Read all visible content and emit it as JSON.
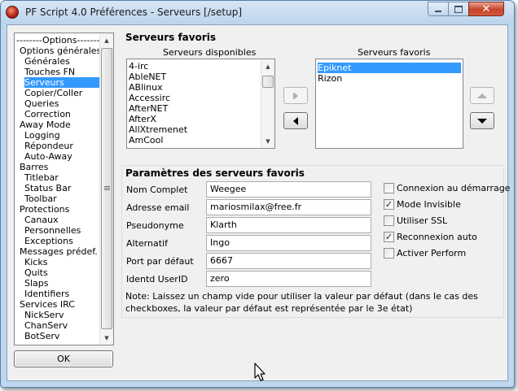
{
  "window": {
    "title": "PF Script 4.0 Préférences - Serveurs [/setup]",
    "close_glyph": "✕"
  },
  "tree": {
    "items": [
      {
        "label": "--------Options--------",
        "indent": 0,
        "selected": false
      },
      {
        "label": "Options générales",
        "indent": 1,
        "selected": false
      },
      {
        "label": "Générales",
        "indent": 2,
        "selected": false
      },
      {
        "label": "Touches FN",
        "indent": 2,
        "selected": false
      },
      {
        "label": "Serveurs",
        "indent": 2,
        "selected": true
      },
      {
        "label": "Copier/Coller",
        "indent": 2,
        "selected": false
      },
      {
        "label": "Queries",
        "indent": 2,
        "selected": false
      },
      {
        "label": "Correction",
        "indent": 2,
        "selected": false
      },
      {
        "label": "Away Mode",
        "indent": 1,
        "selected": false
      },
      {
        "label": "Logging",
        "indent": 2,
        "selected": false
      },
      {
        "label": "Répondeur",
        "indent": 2,
        "selected": false
      },
      {
        "label": "Auto-Away",
        "indent": 2,
        "selected": false
      },
      {
        "label": "Barres",
        "indent": 1,
        "selected": false
      },
      {
        "label": "Titlebar",
        "indent": 2,
        "selected": false
      },
      {
        "label": "Status Bar",
        "indent": 2,
        "selected": false
      },
      {
        "label": "Toolbar",
        "indent": 2,
        "selected": false
      },
      {
        "label": "Protections",
        "indent": 1,
        "selected": false
      },
      {
        "label": "Canaux",
        "indent": 2,
        "selected": false
      },
      {
        "label": "Personnelles",
        "indent": 2,
        "selected": false
      },
      {
        "label": "Exceptions",
        "indent": 2,
        "selected": false
      },
      {
        "label": "Messages prédef.",
        "indent": 1,
        "selected": false
      },
      {
        "label": "Kicks",
        "indent": 2,
        "selected": false
      },
      {
        "label": "Quits",
        "indent": 2,
        "selected": false
      },
      {
        "label": "Slaps",
        "indent": 2,
        "selected": false
      },
      {
        "label": "Identifiers",
        "indent": 2,
        "selected": false
      },
      {
        "label": "Services IRC",
        "indent": 1,
        "selected": false
      },
      {
        "label": "NickServ",
        "indent": 2,
        "selected": false
      },
      {
        "label": "ChanServ",
        "indent": 2,
        "selected": false
      },
      {
        "label": "BotServ",
        "indent": 2,
        "selected": false
      }
    ]
  },
  "ok_label": "OK",
  "servers": {
    "section_title": "Serveurs favoris",
    "available_header": "Serveurs disponibles",
    "favorites_header": "Serveurs favoris",
    "available": [
      "4-irc",
      "AbleNET",
      "ABlinux",
      "Accessirc",
      "AfterNET",
      "AfterX",
      "AllXtremenet",
      "AmCool"
    ],
    "favorites": [
      {
        "label": "Epiknet",
        "selected": true
      },
      {
        "label": "Rizon",
        "selected": false
      }
    ]
  },
  "params": {
    "section_title": "Paramètres des serveurs favoris",
    "fields": [
      {
        "label": "Nom Complet",
        "value": "Weegee"
      },
      {
        "label": "Adresse email",
        "value": "mariosmilax@free.fr"
      },
      {
        "label": "Pseudonyme",
        "value": "Klarth"
      },
      {
        "label": "Alternatif",
        "value": "Ingo"
      },
      {
        "label": "Port par défaut",
        "value": "6667"
      },
      {
        "label": "Identd UserID",
        "value": "zero"
      }
    ],
    "checkboxes": [
      {
        "label": "Connexion au démarrage",
        "checked": false
      },
      {
        "label": "Mode Invisible",
        "checked": true
      },
      {
        "label": "Utiliser SSL",
        "checked": false
      },
      {
        "label": "Reconnexion auto",
        "checked": true
      },
      {
        "label": "Activer Perform",
        "checked": false
      }
    ],
    "check_glyph": "✓",
    "note": "Note: Laissez un champ vide pour utiliser la valeur par défaut (dans le cas des checkboxes, la valeur par défaut est représentée par le 3e état)"
  }
}
